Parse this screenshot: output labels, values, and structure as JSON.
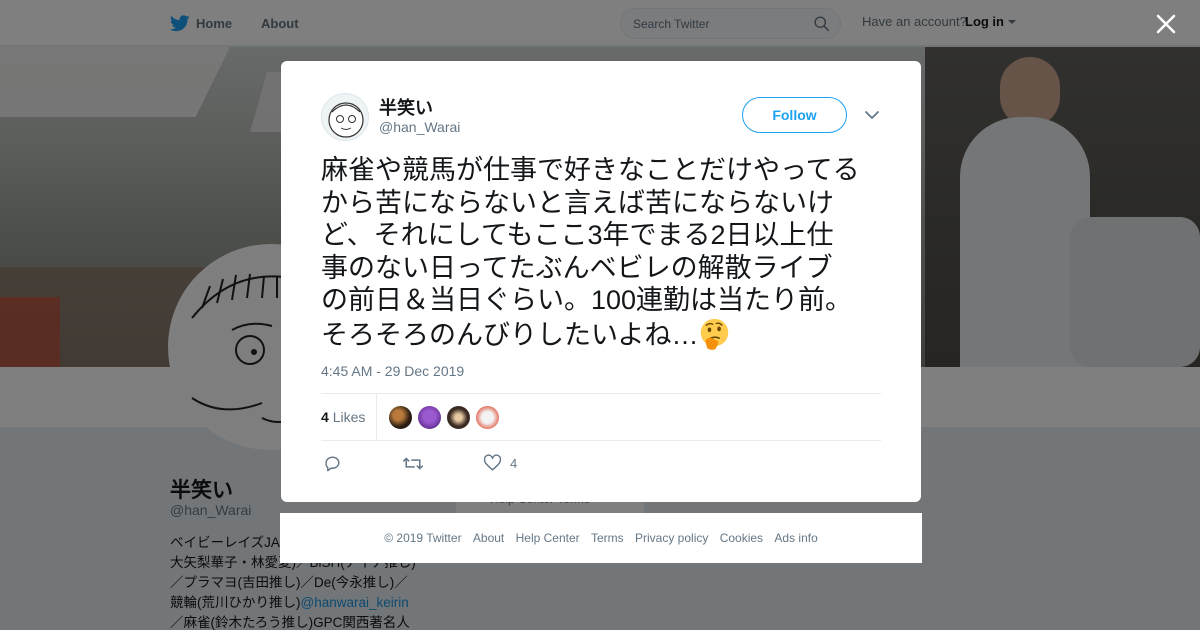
{
  "nav": {
    "home_label": "Home",
    "about_label": "About",
    "search_placeholder": "Search Twitter",
    "account_prompt": "Have an account?",
    "login_label": "Log in"
  },
  "profile": {
    "name": "半笑い",
    "handle": "@han_Warai",
    "bio_lines": [
      "ベイビーレイズJA",
      "大矢梨華子・林愛夏)／BiSH(アイナ推し)",
      "／プラマヨ(吉田推し)／De(今永推し)／",
      "競輪(荒川ひかり推し)",
      "／麻雀(鈴木たろう推し)GPC関西著名人"
    ],
    "bio_mention": "@hanwarai_keirin",
    "side_footer": "Help Center   Terms"
  },
  "tweet": {
    "author_name": "半笑い",
    "author_handle": "@han_Warai",
    "follow_label": "Follow",
    "text_lines": [
      "麻雀や競馬が仕事で好きなことだけやってる",
      "から苦にならないと言えば苦にならないけ",
      "ど、それにしてもここ3年でまる2日以上仕",
      "事のない日ってたぶんベビレの解散ライブ",
      "の前日＆当日ぐらい。100連勤は当たり前。",
      "そろそろのんびりしたいよね…"
    ],
    "emoji": "thinking-face",
    "timestamp": "4:45 AM - 29 Dec 2019",
    "likes_count": "4",
    "likes_label": "Likes",
    "like_action_count": "4"
  },
  "footer": {
    "links": [
      "© 2019 Twitter",
      "About",
      "Help Center",
      "Terms",
      "Privacy policy",
      "Cookies",
      "Ads info"
    ]
  },
  "colors": {
    "accent": "#1da1f2",
    "overlay": "rgba(0,0,0,0.5)"
  }
}
